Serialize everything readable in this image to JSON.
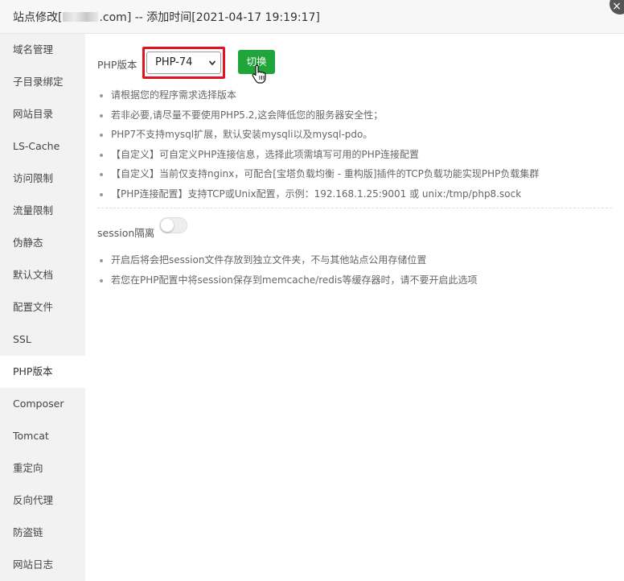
{
  "window": {
    "title_prefix": "站点修改[",
    "title_suffix": ".com] -- 添加时间[2021-04-17 19:19:17]",
    "close_symbol": "×"
  },
  "sidebar": {
    "items": [
      {
        "label": "域名管理"
      },
      {
        "label": "子目录绑定"
      },
      {
        "label": "网站目录"
      },
      {
        "label": "LS-Cache"
      },
      {
        "label": "访问限制"
      },
      {
        "label": "流量限制"
      },
      {
        "label": "伪静态"
      },
      {
        "label": "默认文档"
      },
      {
        "label": "配置文件"
      },
      {
        "label": "SSL"
      },
      {
        "label": "PHP版本",
        "active": true
      },
      {
        "label": "Composer"
      },
      {
        "label": "Tomcat"
      },
      {
        "label": "重定向"
      },
      {
        "label": "反向代理"
      },
      {
        "label": "防盗链"
      },
      {
        "label": "网站日志"
      }
    ]
  },
  "php": {
    "label": "PHP版本",
    "selected": "PHP-74",
    "switch_label": "切换",
    "notes": [
      "请根据您的程序需求选择版本",
      "若非必要,请尽量不要使用PHP5.2,这会降低您的服务器安全性；",
      "PHP7不支持mysql扩展，默认安装mysqli以及mysql-pdo。",
      "【自定义】可自定义PHP连接信息，选择此项需填写可用的PHP连接配置",
      "【自定义】当前仅支持nginx，可配合[宝塔负载均衡 - 重构版]插件的TCP负载功能实现PHP负载集群",
      "【PHP连接配置】支持TCP或Unix配置，示例：192.168.1.25:9001 或 unix:/tmp/php8.sock"
    ]
  },
  "session": {
    "label": "session隔离",
    "enabled": false,
    "notes": [
      "开启后将会把session文件存放到独立文件夹，不与其他站点公用存储位置",
      "若您在PHP配置中将session保存到memcache/redis等缓存器时，请不要开启此选项"
    ]
  },
  "colors": {
    "accent": "#20a53a",
    "highlight": "#e0141e"
  }
}
